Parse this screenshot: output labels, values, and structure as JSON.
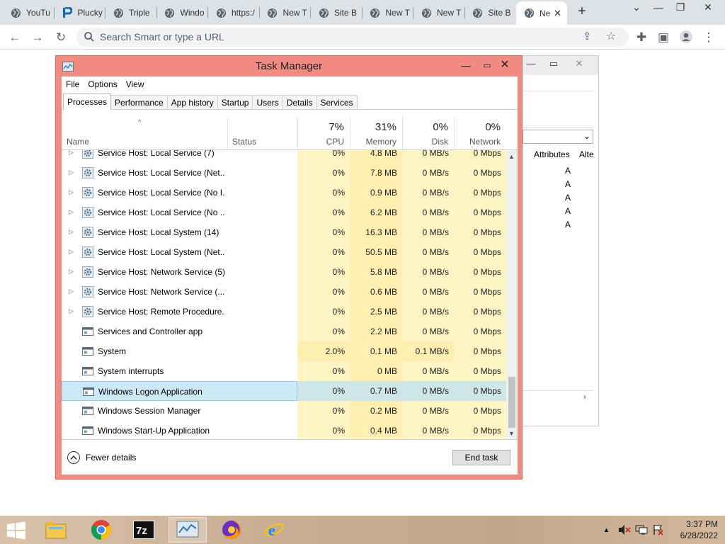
{
  "browser": {
    "tabs": [
      {
        "label": "YouTu",
        "icon": "globe-icon"
      },
      {
        "label": "Plucky",
        "icon": "p-logo-icon"
      },
      {
        "label": "Triple",
        "icon": "globe-icon"
      },
      {
        "label": "Windo",
        "icon": "globe-icon"
      },
      {
        "label": "https:/",
        "icon": "globe-icon"
      },
      {
        "label": "New T",
        "icon": "globe-icon"
      },
      {
        "label": "Site B",
        "icon": "globe-icon"
      },
      {
        "label": "New T",
        "icon": "globe-icon"
      },
      {
        "label": "New T",
        "icon": "globe-icon"
      },
      {
        "label": "Site B",
        "icon": "globe-icon"
      },
      {
        "label": "Ne",
        "icon": "globe-icon",
        "active": true
      }
    ],
    "omnibox_placeholder": "Search Smart or type a URL",
    "accent": "#dee1e6"
  },
  "bg_window": {
    "column_attributes": "Attributes",
    "column_alt": "Alte",
    "attr_values": [
      "A",
      "A",
      "A",
      "A",
      "A"
    ]
  },
  "taskmanager": {
    "title": "Task Manager",
    "menu": [
      "File",
      "Options",
      "View"
    ],
    "tabs": [
      "Processes",
      "Performance",
      "App history",
      "Startup",
      "Users",
      "Details",
      "Services"
    ],
    "active_tab": "Processes",
    "columns": {
      "name": "Name",
      "status": "Status",
      "cpu": {
        "pct": "7%",
        "label": "CPU"
      },
      "memory": {
        "pct": "31%",
        "label": "Memory"
      },
      "disk": {
        "pct": "0%",
        "label": "Disk"
      },
      "network": {
        "pct": "0%",
        "label": "Network"
      }
    },
    "processes": [
      {
        "name": "Service Host: Local Service (7)",
        "cpu": "0%",
        "memory": "4.8 MB",
        "disk": "0 MB/s",
        "network": "0 Mbps",
        "expandable": true,
        "type": "service"
      },
      {
        "name": "Service Host: Local Service (Net...",
        "cpu": "0%",
        "memory": "7.8 MB",
        "disk": "0 MB/s",
        "network": "0 Mbps",
        "expandable": true,
        "type": "service"
      },
      {
        "name": "Service Host: Local Service (No I...",
        "cpu": "0%",
        "memory": "0.9 MB",
        "disk": "0 MB/s",
        "network": "0 Mbps",
        "expandable": true,
        "type": "service"
      },
      {
        "name": "Service Host: Local Service (No ...",
        "cpu": "0%",
        "memory": "6.2 MB",
        "disk": "0 MB/s",
        "network": "0 Mbps",
        "expandable": true,
        "type": "service"
      },
      {
        "name": "Service Host: Local System (14)",
        "cpu": "0%",
        "memory": "16.3 MB",
        "disk": "0 MB/s",
        "network": "0 Mbps",
        "expandable": true,
        "type": "service"
      },
      {
        "name": "Service Host: Local System (Net...",
        "cpu": "0%",
        "memory": "50.5 MB",
        "disk": "0 MB/s",
        "network": "0 Mbps",
        "expandable": true,
        "type": "service"
      },
      {
        "name": "Service Host: Network Service (5)",
        "cpu": "0%",
        "memory": "5.8 MB",
        "disk": "0 MB/s",
        "network": "0 Mbps",
        "expandable": true,
        "type": "service"
      },
      {
        "name": "Service Host: Network Service (...",
        "cpu": "0%",
        "memory": "0.6 MB",
        "disk": "0 MB/s",
        "network": "0 Mbps",
        "expandable": true,
        "type": "service"
      },
      {
        "name": "Service Host: Remote Procedure...",
        "cpu": "0%",
        "memory": "2.5 MB",
        "disk": "0 MB/s",
        "network": "0 Mbps",
        "expandable": true,
        "type": "service"
      },
      {
        "name": "Services and Controller app",
        "cpu": "0%",
        "memory": "2.2 MB",
        "disk": "0 MB/s",
        "network": "0 Mbps",
        "expandable": false,
        "type": "app"
      },
      {
        "name": "System",
        "cpu": "2.0%",
        "memory": "0.1 MB",
        "disk": "0.1 MB/s",
        "network": "0 Mbps",
        "expandable": false,
        "type": "app"
      },
      {
        "name": "System interrupts",
        "cpu": "0%",
        "memory": "0 MB",
        "disk": "0 MB/s",
        "network": "0 Mbps",
        "expandable": false,
        "type": "app"
      },
      {
        "name": "Windows Logon Application",
        "cpu": "0%",
        "memory": "0.7 MB",
        "disk": "0 MB/s",
        "network": "0 Mbps",
        "expandable": false,
        "type": "app",
        "selected": true
      },
      {
        "name": "Windows Session Manager",
        "cpu": "0%",
        "memory": "0.2 MB",
        "disk": "0 MB/s",
        "network": "0 Mbps",
        "expandable": false,
        "type": "app"
      },
      {
        "name": "Windows Start-Up Application",
        "cpu": "0%",
        "memory": "0.4 MB",
        "disk": "0 MB/s",
        "network": "0 Mbps",
        "expandable": false,
        "type": "app"
      }
    ],
    "fewer_details": "Fewer details",
    "end_task": "End task",
    "frame_color": "#f28b82",
    "selection_color": "#cce8f5"
  },
  "taskbar": {
    "apps": [
      "file-explorer-icon",
      "chrome-icon",
      "7zip-icon",
      "task-manager-icon",
      "firefox-icon",
      "internet-explorer-icon"
    ],
    "active_app": "task-manager-icon",
    "time": "3:37 PM",
    "date": "6/28/2022"
  }
}
